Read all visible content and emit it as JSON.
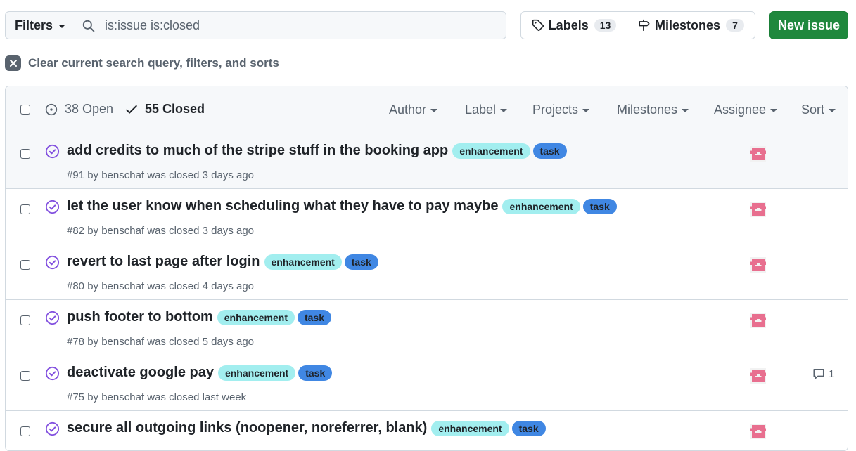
{
  "toolbar": {
    "filters_label": "Filters",
    "search_value": "is:issue is:closed",
    "labels_label": "Labels",
    "labels_count": "13",
    "milestones_label": "Milestones",
    "milestones_count": "7",
    "new_issue_label": "New issue"
  },
  "clear_filter": {
    "label": "Clear current search query, filters, and sorts"
  },
  "header": {
    "open_label": "38 Open",
    "closed_label": "55 Closed",
    "filters": [
      "Author",
      "Label",
      "Projects",
      "Milestones",
      "Assignee",
      "Sort"
    ]
  },
  "issues": [
    {
      "title": "add credits to much of the stripe stuff in the booking app",
      "labels": [
        "enhancement",
        "task"
      ],
      "meta": "#91 by benschaf was closed 3 days ago",
      "comments": ""
    },
    {
      "title": "let the user know when scheduling what they have to pay maybe",
      "labels": [
        "enhancement",
        "task"
      ],
      "meta": "#82 by benschaf was closed 3 days ago",
      "comments": ""
    },
    {
      "title": "revert to last page after login",
      "labels": [
        "enhancement",
        "task"
      ],
      "meta": "#80 by benschaf was closed 4 days ago",
      "comments": ""
    },
    {
      "title": "push footer to bottom",
      "labels": [
        "enhancement",
        "task"
      ],
      "meta": "#78 by benschaf was closed 5 days ago",
      "comments": ""
    },
    {
      "title": "deactivate google pay",
      "labels": [
        "enhancement",
        "task"
      ],
      "meta": "#75 by benschaf was closed last week",
      "comments": "1"
    },
    {
      "title": "secure all outgoing links (noopener, noreferrer, blank)",
      "labels": [
        "enhancement",
        "task"
      ],
      "meta": "",
      "comments": ""
    }
  ],
  "colors": {
    "primary_button": "#1f883d",
    "closed_icon": "#8250df",
    "label_enhancement": "#a2eeef",
    "label_task": "#4087e3",
    "avatar": "#e86f8f"
  }
}
